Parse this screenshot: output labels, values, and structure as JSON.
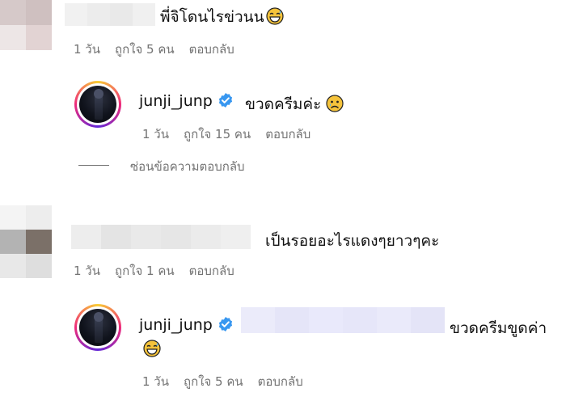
{
  "comments": [
    {
      "text": "พี่จิโดนไรข่วนน",
      "meta": {
        "time": "1 วัน",
        "likes": "ถูกใจ 5 คน",
        "reply": "ตอบกลับ"
      },
      "emoji": "grin-sweat-emoji"
    },
    {
      "text": "เป็นรอยอะไรแดงๆยาวๆคะ",
      "meta": {
        "time": "1 วัน",
        "likes": "ถูกใจ 1 คน",
        "reply": "ตอบกลับ"
      }
    }
  ],
  "replies": [
    {
      "username": "junji_junp",
      "text": "ขวดครีมค่ะ",
      "emoji": "sad-face-emoji",
      "meta": {
        "time": "1 วัน",
        "likes": "ถูกใจ 15 คน",
        "reply": "ตอบกลับ"
      },
      "hide_replies": "ซ่อนข้อความตอบกลับ"
    },
    {
      "username": "junji_junp",
      "text": "ขวดครีมขูดค่า",
      "emoji": "grin-sweat-emoji",
      "meta": {
        "time": "1 วัน",
        "likes": "ถูกใจ 5 คน",
        "reply": "ตอบกลับ"
      }
    }
  ],
  "colors": {
    "text": "#111111",
    "meta": "#737373",
    "verified": "#3897f0",
    "mention_blur": "#e8e8fb"
  }
}
